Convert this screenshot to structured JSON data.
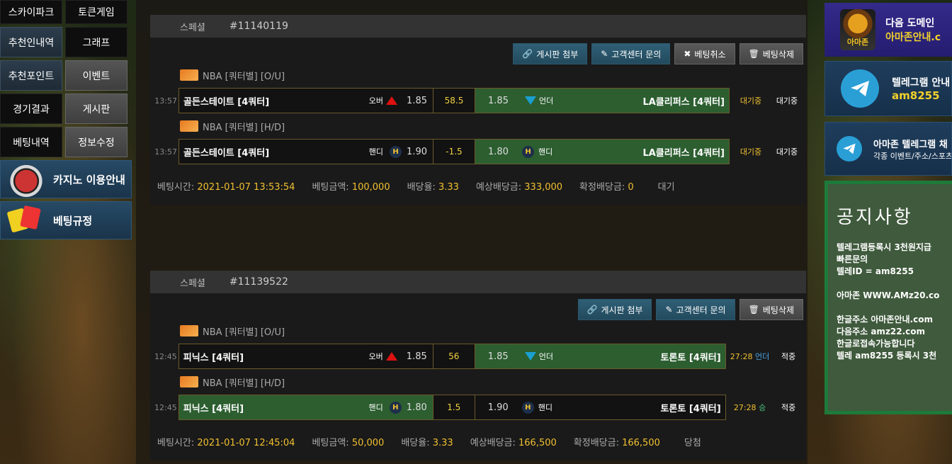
{
  "left_menu": {
    "items": [
      {
        "label": "스카이파크",
        "style": "top"
      },
      {
        "label": "토큰게임",
        "style": "top"
      },
      {
        "label": "추천인내역",
        "style": "dark-blue"
      },
      {
        "label": "그래프",
        "style": ""
      },
      {
        "label": "추천포인트",
        "style": "dark-blue"
      },
      {
        "label": "이벤트",
        "style": "grey"
      },
      {
        "label": "경기결과",
        "style": ""
      },
      {
        "label": "게시판",
        "style": "grey"
      },
      {
        "label": "베팅내역",
        "style": ""
      },
      {
        "label": "정보수정",
        "style": "grey"
      }
    ],
    "casino_banner": "카지노 이용안내",
    "rules_banner": "베팅규정"
  },
  "bets": [
    {
      "type_label": "스페셜",
      "id": "#11140119",
      "actions": [
        "게시판 첨부",
        "고객센터 문의",
        "베팅취소",
        "베팅삭제"
      ],
      "rows": [
        {
          "league": "NBA [쿼터별] [O/U]",
          "time": "13:57",
          "home": "골든스테이트 [4쿼터]",
          "home_sel": "오버",
          "home_odd": "1.85",
          "mid": "58.5",
          "away_odd": "1.85",
          "away_sel": "언더",
          "away": "LA클리퍼스 [4쿼터]",
          "status1": "대기중",
          "status2": "대기중"
        },
        {
          "league": "NBA [쿼터별] [H/D]",
          "time": "13:57",
          "home": "골든스테이트 [4쿼터]",
          "home_sel": "핸디",
          "home_odd": "1.90",
          "mid": "-1.5",
          "away_odd": "1.80",
          "away_sel": "핸디",
          "away": "LA클리퍼스 [4쿼터]",
          "status1": "대기중",
          "status2": "대기중"
        }
      ],
      "summary": {
        "time_label": "베팅시간:",
        "time": "2021-01-07 13:53:54",
        "amount_label": "베팅금액:",
        "amount": "100,000",
        "rate_label": "배당율:",
        "rate": "3.33",
        "expect_label": "예상배당금:",
        "expect": "333,000",
        "confirm_label": "확정배당금:",
        "confirm": "0",
        "status": "대기"
      }
    },
    {
      "type_label": "스페셜",
      "id": "#11139522",
      "actions": [
        "게시판 첨부",
        "고객센터 문의",
        "베팅삭제"
      ],
      "rows": [
        {
          "league": "NBA [쿼터별] [O/U]",
          "time": "12:45",
          "home": "피닉스 [4쿼터]",
          "home_sel": "오버",
          "home_odd": "1.85",
          "mid": "56",
          "away_odd": "1.85",
          "away_sel": "언더",
          "away": "토론토 [4쿼터]",
          "status1_score": "27:28",
          "status1_result": "언더",
          "status2": "적중"
        },
        {
          "league": "NBA [쿼터별] [H/D]",
          "time": "12:45",
          "home": "피닉스 [4쿼터]",
          "home_sel": "핸디",
          "home_odd": "1.80",
          "mid": "1.5",
          "away_odd": "1.90",
          "away_sel": "핸디",
          "away": "토론토 [4쿼터]",
          "status1_score": "27:28",
          "status1_result": "승",
          "status2": "적중"
        }
      ],
      "summary": {
        "time_label": "베팅시간:",
        "time": "2021-01-07 12:45:04",
        "amount_label": "베팅금액:",
        "amount": "50,000",
        "rate_label": "배당율:",
        "rate": "3.33",
        "expect_label": "예상배당금:",
        "expect": "166,500",
        "confirm_label": "확정배당금:",
        "confirm": "166,500",
        "status": "당첨"
      }
    }
  ],
  "right": {
    "domain_banner": {
      "line1": "다음 도메인",
      "line2": "아마존안내.c",
      "logo_text": "아마존"
    },
    "telegram_banner": {
      "line1": "텔레그램 안내",
      "line2": "am8255"
    },
    "telegram2_banner": {
      "line1": "아마존 텔레그램 채",
      "line2": "각종 이벤트/주소/스포츠"
    },
    "notice": {
      "title": "공지사항",
      "lines": [
        "텔레그램등록시 3천원지급",
        "빠른문의",
        "텔레ID = am8255",
        "",
        "아마존  WWW.AMz20.co",
        "",
        "한글주소 아마존안내.com",
        "다음주소 amz22.com",
        "한글로접속가능합니다",
        "텔레 am8255 등록시 3천"
      ]
    }
  },
  "colors": {
    "accent_yellow": "#f0c030",
    "bet_green": "#2c5e30",
    "over_red": "#d11111",
    "under_blue": "#1aa0d0"
  }
}
